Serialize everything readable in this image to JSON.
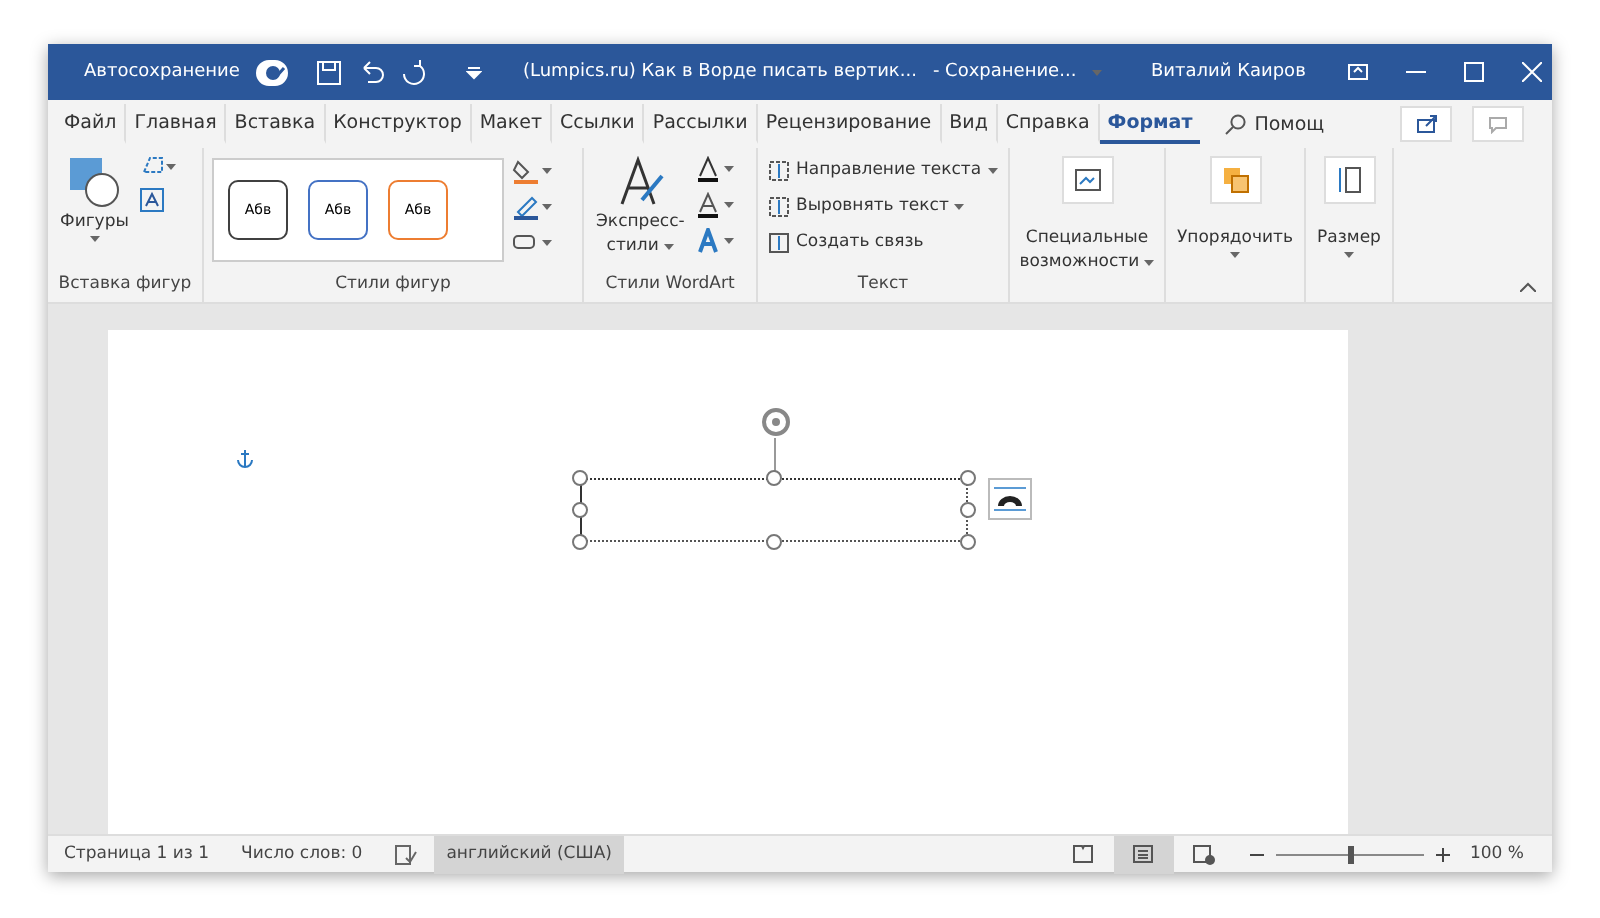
{
  "title_bar": {
    "autosave_label": "Автосохранение",
    "autosave_on": true,
    "document_title": "(Lumpics.ru) Как в Ворде писать вертик...",
    "save_status": "- Сохранение...",
    "user_name": "Виталий Каиров"
  },
  "tabs": [
    {
      "label": "Файл",
      "selected": false
    },
    {
      "label": "Главная",
      "selected": false
    },
    {
      "label": "Вставка",
      "selected": false
    },
    {
      "label": "Конструктор",
      "selected": false
    },
    {
      "label": "Макет",
      "selected": false
    },
    {
      "label": "Ссылки",
      "selected": false
    },
    {
      "label": "Рассылки",
      "selected": false
    },
    {
      "label": "Рецензирование",
      "selected": false
    },
    {
      "label": "Вид",
      "selected": false
    },
    {
      "label": "Справка",
      "selected": false
    },
    {
      "label": "Формат",
      "selected": true
    }
  ],
  "search": {
    "label": "Помощ"
  },
  "ribbon": {
    "insert_shapes": {
      "button": "Фигуры",
      "group_label": "Вставка фигур"
    },
    "shape_styles": {
      "thumbnails": [
        {
          "label": "Абв",
          "color": "#404040"
        },
        {
          "label": "Абв",
          "color": "#4472c4"
        },
        {
          "label": "Абв",
          "color": "#ed7d31"
        }
      ],
      "group_label": "Стили фигур"
    },
    "wordart": {
      "button_line_1": "Экспресс-",
      "button_line_2": "стили",
      "group_label": "Стили WordArt"
    },
    "text": {
      "commands": [
        "Направление текста",
        "Выровнять текст",
        "Создать связь"
      ],
      "group_label": "Текст"
    },
    "accessibility": {
      "line_1": "Специальные",
      "line_2": "возможности"
    },
    "arrange": {
      "label": "Упорядочить"
    },
    "size": {
      "label": "Размер"
    }
  },
  "status_bar": {
    "page": "Страница 1 из 1",
    "words": "Число слов: 0",
    "language": "английский (США)",
    "views": [
      {
        "kind": "read",
        "selected": false
      },
      {
        "kind": "print",
        "selected": true
      },
      {
        "kind": "web",
        "selected": false
      }
    ],
    "zoom": {
      "level": 0.5,
      "reading": "100 %"
    }
  }
}
